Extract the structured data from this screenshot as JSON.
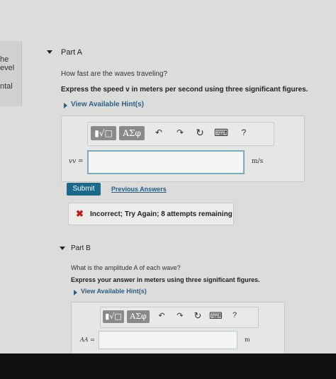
{
  "sidebar": {
    "line1": "he",
    "line2": "evel",
    "line3": "ntal"
  },
  "partA": {
    "title": "Part A",
    "question": "How fast are the waves traveling?",
    "instruction": "Express the speed v in meters per second using three significant figures.",
    "hint_label": "View Available Hint(s)",
    "toolbar": {
      "template_btn": "▮√□",
      "greek_btn": "ΑΣφ",
      "undo": "↶",
      "redo": "↷",
      "reset": "↻",
      "keyboard": "⌨",
      "help": "?"
    },
    "input_label": "vv =",
    "input_value": "",
    "unit": "m/s",
    "submit_label": "Submit",
    "previous_answers_label": "Previous Answers",
    "feedback": "Incorrect; Try Again; 8 attempts remaining"
  },
  "partB": {
    "title": "Part B",
    "question": "What is the amplitude A of each wave?",
    "instruction": "Express your answer in meters using three significant figures.",
    "hint_label": "View Available Hint(s)",
    "toolbar": {
      "template_btn": "▮√□",
      "greek_btn": "ΑΣφ",
      "undo": "↶",
      "redo": "↷",
      "reset": "↻",
      "keyboard": "⌨",
      "help": "?"
    },
    "input_label": "AA =",
    "input_value": "",
    "unit": "m"
  }
}
